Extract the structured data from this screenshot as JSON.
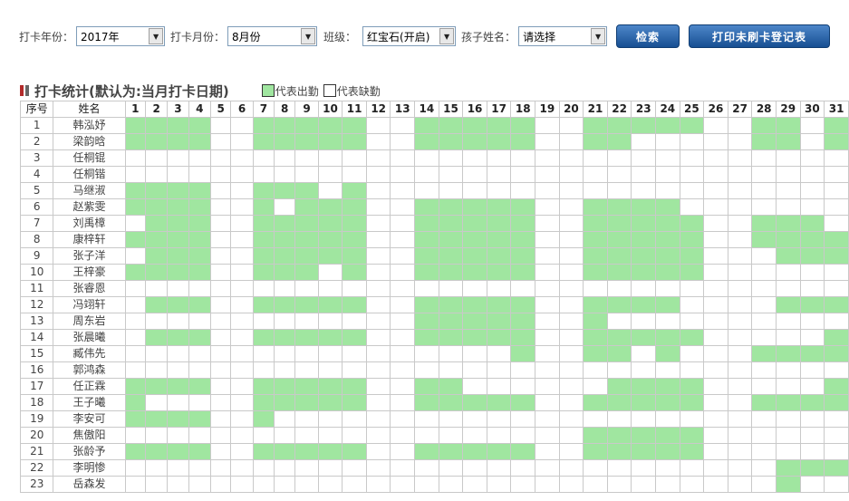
{
  "filters": {
    "year_label": "打卡年份：",
    "year_value": "2017年",
    "month_label": "打卡月份：",
    "month_value": "8月份",
    "class_label": "班级：",
    "class_value": "红宝石(开启)",
    "child_label": "孩子姓名：",
    "child_value": "请选择",
    "search_button": "检索",
    "print_button": "打印未刷卡登记表"
  },
  "section": {
    "title": "打卡统计(默认为:当月打卡日期)",
    "legend_present": "代表出勤",
    "legend_absent": "代表缺勤",
    "present_color": "#a0e6a0"
  },
  "table": {
    "col_index": "序号",
    "col_name": "姓名",
    "days": [
      "1",
      "2",
      "3",
      "4",
      "5",
      "6",
      "7",
      "8",
      "9",
      "10",
      "11",
      "12",
      "13",
      "14",
      "15",
      "16",
      "17",
      "18",
      "19",
      "20",
      "21",
      "22",
      "23",
      "24",
      "25",
      "26",
      "27",
      "28",
      "29",
      "30",
      "31"
    ],
    "rows": [
      {
        "no": "1",
        "name": "韩泓妤",
        "att": "1111001111100111110011111001101"
      },
      {
        "no": "2",
        "name": "梁韵晗",
        "att": "1111001111100111110011000001101"
      },
      {
        "no": "3",
        "name": "任桐锟",
        "att": "0000000000000000000000000000000"
      },
      {
        "no": "4",
        "name": "任桐锴",
        "att": "0000000000000000000000000000000"
      },
      {
        "no": "5",
        "name": "马继淑",
        "att": "1111001110100000000000000000000"
      },
      {
        "no": "6",
        "name": "赵紫雯",
        "att": "1111001011100111110011110000000"
      },
      {
        "no": "7",
        "name": "刘禹樟",
        "att": "0111001111100111110011111001110"
      },
      {
        "no": "8",
        "name": "康梓轩",
        "att": "1111001111100111110011111001111"
      },
      {
        "no": "9",
        "name": "张子洋",
        "att": "0111001111100111110011111000111"
      },
      {
        "no": "10",
        "name": "王梓豪",
        "att": "1111001110100111110011111000000"
      },
      {
        "no": "11",
        "name": "张睿恩",
        "att": "0000000000000000000000000000000"
      },
      {
        "no": "12",
        "name": "冯翊轩",
        "att": "0111001111100111110011110000111"
      },
      {
        "no": "13",
        "name": "周东岩",
        "att": "0000000000000111110010000000000"
      },
      {
        "no": "14",
        "name": "张晨曦",
        "att": "0111001111100111110011111000001"
      },
      {
        "no": "15",
        "name": "臧伟先",
        "att": "0000000000000000010011010001111"
      },
      {
        "no": "16",
        "name": "郭鸿森",
        "att": "0000000000000000000000000000000"
      },
      {
        "no": "17",
        "name": "任正霖",
        "att": "1111001111100110000001111000001"
      },
      {
        "no": "18",
        "name": "王子曦",
        "att": "1000001111100111110011111001111"
      },
      {
        "no": "19",
        "name": "李安可",
        "att": "1111001000000000000000000000000"
      },
      {
        "no": "20",
        "name": "焦傲阳",
        "att": "0000000000000000000011111000000"
      },
      {
        "no": "21",
        "name": "张龄予",
        "att": "1111001111100111110011111000000"
      },
      {
        "no": "22",
        "name": "李明惨",
        "att": "0000000000000000000000000000111"
      },
      {
        "no": "23",
        "name": "岳森发",
        "att": "0000000000000000000000000000100"
      }
    ]
  }
}
